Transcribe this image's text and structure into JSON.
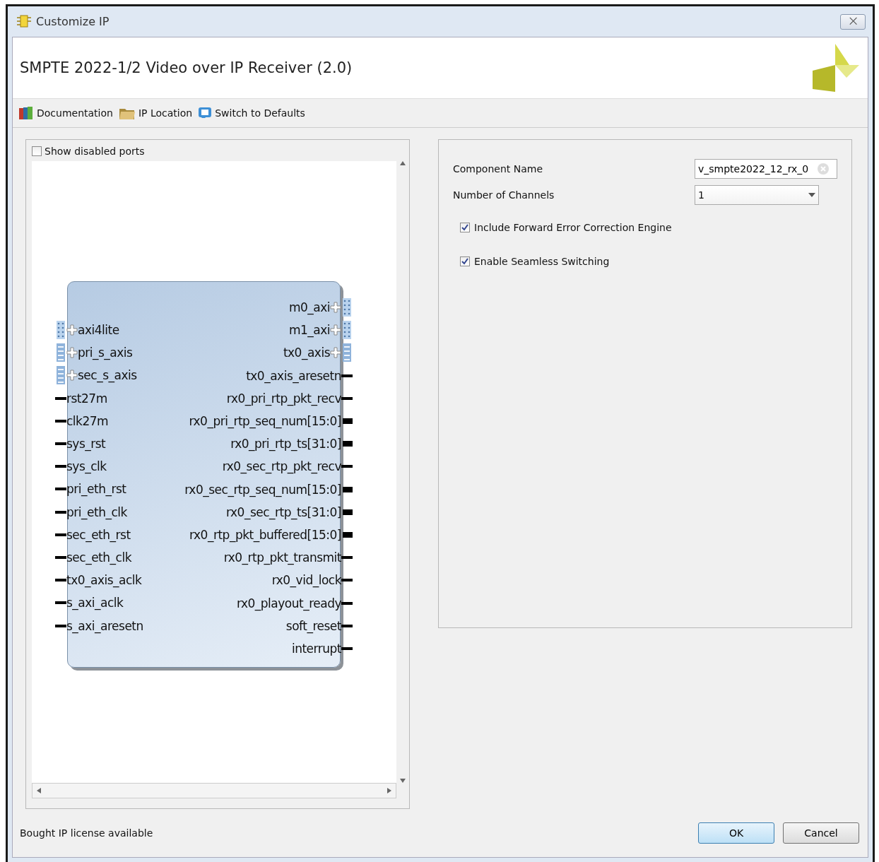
{
  "window": {
    "title": "Customize IP",
    "close": "⨉"
  },
  "header": {
    "title": "SMPTE 2022-1/2 Video over IP Receiver (2.0)"
  },
  "toolbar": [
    {
      "kind": "docs",
      "label": "Documentation"
    },
    {
      "kind": "folder",
      "label": "IP Location"
    },
    {
      "kind": "reset",
      "label": "Switch to Defaults"
    }
  ],
  "diagram": {
    "show_disabled_ports": {
      "label": "Show disabled ports",
      "checked": false
    },
    "left_ports": [
      {
        "kind": "bus",
        "name": "axi4lite"
      },
      {
        "kind": "stream",
        "name": "pri_s_axis"
      },
      {
        "kind": "stream",
        "name": "sec_s_axis"
      },
      {
        "kind": "signal",
        "name": "rst27m"
      },
      {
        "kind": "signal",
        "name": "clk27m"
      },
      {
        "kind": "signal",
        "name": "sys_rst"
      },
      {
        "kind": "signal",
        "name": "sys_clk"
      },
      {
        "kind": "signal",
        "name": "pri_eth_rst"
      },
      {
        "kind": "signal",
        "name": "pri_eth_clk"
      },
      {
        "kind": "signal",
        "name": "sec_eth_rst"
      },
      {
        "kind": "signal",
        "name": "sec_eth_clk"
      },
      {
        "kind": "signal",
        "name": "tx0_axis_aclk"
      },
      {
        "kind": "signal",
        "name": "s_axi_aclk"
      },
      {
        "kind": "signal",
        "name": "s_axi_aresetn"
      }
    ],
    "right_ports": [
      {
        "kind": "bus",
        "name": "m0_axi"
      },
      {
        "kind": "bus",
        "name": "m1_axi"
      },
      {
        "kind": "stream",
        "name": "tx0_axis"
      },
      {
        "kind": "signal",
        "name": "tx0_axis_aresetn"
      },
      {
        "kind": "signal",
        "name": "rx0_pri_rtp_pkt_recv"
      },
      {
        "kind": "vector",
        "name": "rx0_pri_rtp_seq_num[15:0]"
      },
      {
        "kind": "vector",
        "name": "rx0_pri_rtp_ts[31:0]"
      },
      {
        "kind": "signal",
        "name": "rx0_sec_rtp_pkt_recv"
      },
      {
        "kind": "vector",
        "name": "rx0_sec_rtp_seq_num[15:0]"
      },
      {
        "kind": "vector",
        "name": "rx0_sec_rtp_ts[31:0]"
      },
      {
        "kind": "vector",
        "name": "rx0_rtp_pkt_buffered[15:0]"
      },
      {
        "kind": "signal",
        "name": "rx0_rtp_pkt_transmit"
      },
      {
        "kind": "signal",
        "name": "rx0_vid_lock"
      },
      {
        "kind": "signal",
        "name": "rx0_playout_ready"
      },
      {
        "kind": "signal",
        "name": "soft_reset"
      },
      {
        "kind": "signal",
        "name": "interrupt"
      }
    ]
  },
  "settings": {
    "component_name": {
      "label": "Component Name",
      "value": "v_smpte2022_12_rx_0"
    },
    "channels": {
      "label": "Number of Channels",
      "value": "1"
    },
    "options": [
      {
        "label": "Include Forward Error Correction Engine",
        "checked": true
      },
      {
        "label": "Enable Seamless Switching",
        "checked": true
      }
    ]
  },
  "status": "Bought IP license available",
  "buttons": [
    "OK",
    "Cancel"
  ]
}
